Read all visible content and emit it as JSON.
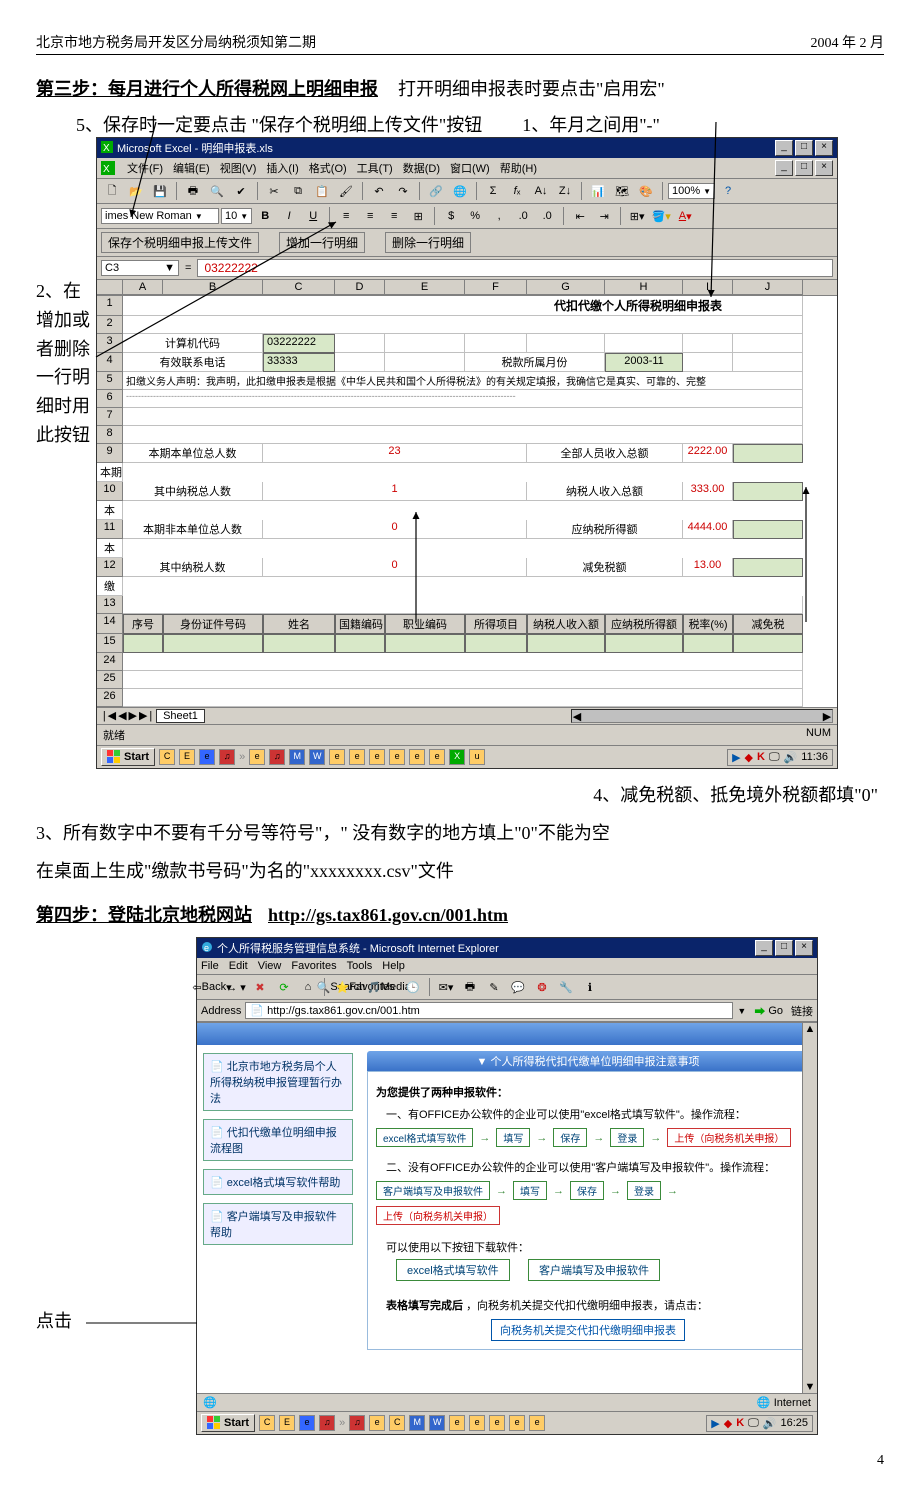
{
  "header": {
    "left": "北京市地方税务局开发区分局纳税须知第二期",
    "right": "2004 年 2 月"
  },
  "step3": {
    "title": "第三步：每月进行个人所得税网上明细申报",
    "suffix": "打开明细申报表时要点击\"启用宏\"",
    "annot5": "5、保存时一定要点击 \"保存个税明细上传文件\"按钮",
    "annot1": "1、年月之间用\"-\"",
    "annot2": "2、在增加或者删除一行明细时用此按钮",
    "annot4": "4、减免税额、抵免境外税额都填\"0\"",
    "annot3": "3、所有数字中不要有千分号等符号\"，\"  没有数字的地方填上\"0\"不能为空",
    "csv_note": "在桌面上生成\"缴款书号码\"为名的\"xxxxxxxx.csv\"文件"
  },
  "excel": {
    "title": "Microsoft Excel - 明细申报表.xls",
    "menu": [
      "文件(F)",
      "编辑(E)",
      "视图(V)",
      "插入(I)",
      "格式(O)",
      "工具(T)",
      "数据(D)",
      "窗口(W)",
      "帮助(H)"
    ],
    "font_name": "imes New Roman",
    "font_size": "10",
    "zoom": "100%",
    "custom_buttons": [
      "保存个税明细申报上传文件",
      "增加一行明细",
      "删除一行明细"
    ],
    "name_box": "C3",
    "formula": "03222222",
    "columns": [
      "",
      "A",
      "B",
      "C",
      "D",
      "E",
      "F",
      "G",
      "H",
      "I",
      "J"
    ],
    "rows": {
      "title": "代扣代缴个人所得税明细申报表",
      "r3": {
        "label": "计算机代码",
        "value": "03222222"
      },
      "r4": {
        "label": "有效联系电话",
        "value": "33333",
        "label2": "税款所属月份",
        "value2": "2003-11"
      },
      "r5": "扣缴义务人声明：我声明，此扣缴申报表是根据《中华人民共和国个人所得税法》的有关规定填报，我确信它是真实、可靠的、完整",
      "r9": {
        "l": "本期本单位总人数",
        "v": "23",
        "l2": "全部人员收入总额",
        "v2": "2222.00",
        "tail": "本期"
      },
      "r10": {
        "l": "其中纳税总人数",
        "v": "1",
        "l2": "纳税人收入总额",
        "v2": "333.00",
        "tail": "本"
      },
      "r11": {
        "l": "本期非本单位总人数",
        "v": "0",
        "l2": "应纳税所得额",
        "v2": "4444.00",
        "tail": "本"
      },
      "r12": {
        "l": "其中纳税人数",
        "v": "0",
        "l2": "减免税额",
        "v2": "13.00",
        "tail": "缴"
      },
      "headers": [
        "序号",
        "身份证件号码",
        "姓名",
        "国籍编码",
        "职业编码",
        "所得项目",
        "纳税人收入额",
        "应纳税所得额",
        "税率(%)",
        "减免税"
      ]
    },
    "sheet": "Sheet1",
    "status": "就绪",
    "caps": "NUM",
    "start": "Start",
    "time": "11:36"
  },
  "step4": {
    "title": "第四步：登陆北京地税网站",
    "url": "http://gs.tax861.gov.cn/001.htm",
    "click_label": "点击"
  },
  "ie": {
    "title": "个人所得税服务管理信息系统 - Microsoft Internet Explorer",
    "menu": [
      "File",
      "Edit",
      "View",
      "Favorites",
      "Tools",
      "Help"
    ],
    "tb": {
      "back": "Back",
      "search": "Search",
      "favorites": "Favorites",
      "media": "Media"
    },
    "addr_label": "Address",
    "addr": "http://gs.tax861.gov.cn/001.htm",
    "go": "Go",
    "links": "链接",
    "side": [
      "北京市地方税务局个人所得税纳税申报管理暂行办法",
      "代扣代缴单位明细申报流程图",
      "excel格式填写软件帮助",
      "客户端填写及申报软件帮助"
    ],
    "notice_title": "▼ 个人所得税代扣代缴单位明细申报注意事项",
    "intro": "为您提供了两种申报软件：",
    "line1": "一、有OFFICE办公软件的企业可以使用\"excel格式填写软件\"。操作流程：",
    "flow1": [
      "excel格式填写软件",
      "填写",
      "保存",
      "登录",
      "上传（向税务机关申报）"
    ],
    "line2": "二、没有OFFICE办公软件的企业可以使用\"客户端填写及申报软件\"。操作流程：",
    "flow2": [
      "客户端填写及申报软件",
      "填写",
      "保存",
      "登录",
      "上传（向税务机关申报）"
    ],
    "dl_label": "可以使用以下按钮下载软件：",
    "dl1": "excel格式填写软件",
    "dl2": "客户端填写及申报软件",
    "done_label": "表格填写完成后",
    "done_suffix": "，向税务机关提交代扣代缴明细申报表，请点击：",
    "submit_btn": "向税务机关提交代扣代缴明细申报表",
    "status_zone": "Internet",
    "start": "Start",
    "time": "16:25"
  },
  "page_number": "4"
}
